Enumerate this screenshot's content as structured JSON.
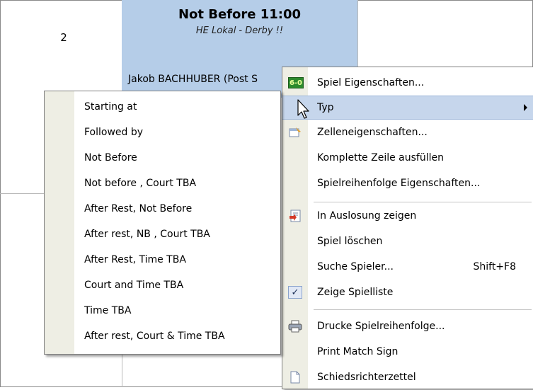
{
  "grid": {
    "row_number": "2",
    "match": {
      "title": "Not Before 11:00",
      "subtitle": "HE Lokal - Derby !!",
      "player": "Jakob BACHHUBER (Post S"
    }
  },
  "context_menu": {
    "items": [
      {
        "label": "Spiel Eigenschaften...",
        "icon": "match-properties-icon"
      },
      {
        "label": "Typ",
        "icon": "",
        "has_submenu": true,
        "highlighted": true
      },
      {
        "label": "Zelleneigenschaften...",
        "icon": "cell-properties-icon"
      },
      {
        "label": "Komplette Zeile ausfüllen",
        "icon": ""
      },
      {
        "label": "Spielreihenfolge Eigenschaften...",
        "icon": ""
      },
      {
        "label": "In Auslosung zeigen",
        "icon": "show-in-draw-icon"
      },
      {
        "label": "Spiel löschen",
        "icon": ""
      },
      {
        "label": "Suche Spieler...",
        "icon": "",
        "shortcut": "Shift+F8"
      },
      {
        "label": "Zeige Spielliste",
        "icon": "check-icon",
        "checked": true
      },
      {
        "label": "Drucke Spielreihenfolge...",
        "icon": "printer-icon"
      },
      {
        "label": "Print Match Sign",
        "icon": ""
      },
      {
        "label": "Schiedsrichterzettel",
        "icon": "document-icon"
      }
    ],
    "icon_glyphs": {
      "match": "6-0",
      "check": "✓"
    }
  },
  "type_submenu": {
    "items": [
      "Starting at",
      "Followed by",
      "Not Before",
      "Not before , Court TBA",
      "After Rest, Not Before",
      "After rest, NB , Court TBA",
      "After Rest, Time TBA",
      "Court and Time TBA",
      "Time TBA",
      "After rest, Court & Time TBA"
    ]
  },
  "colors": {
    "match_cell": "#b5cde8",
    "highlight": "#c6d6ec",
    "gutter": "#eeeee4"
  }
}
